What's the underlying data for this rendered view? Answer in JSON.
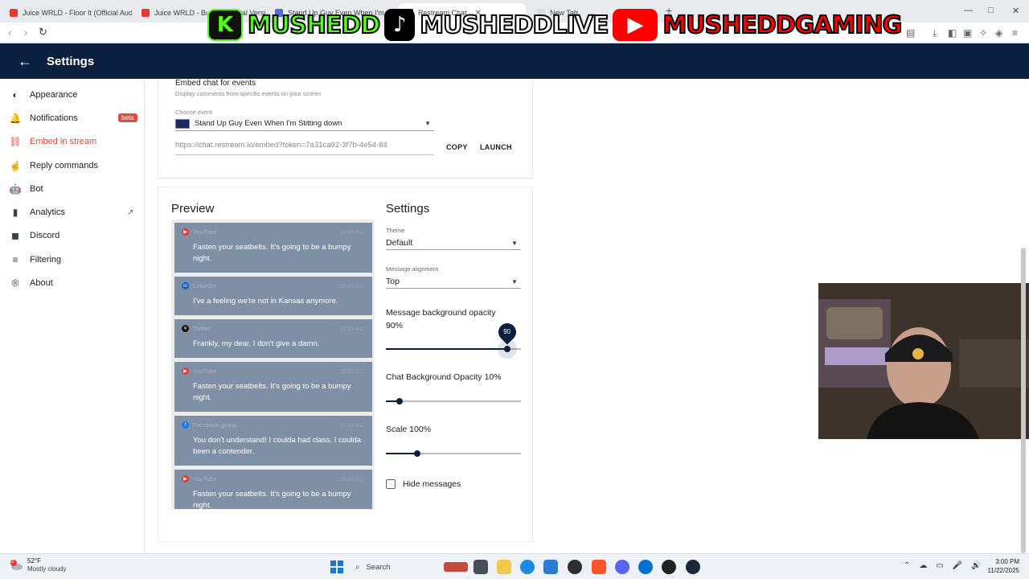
{
  "browser": {
    "tabs": [
      {
        "title": "Juice WRLD - Floor It (Official Audio)",
        "fav_color": "#e53935"
      },
      {
        "title": "Juice WRLD - Busch (Official Version)",
        "fav_color": "#e53935"
      },
      {
        "title": "Stand Up Guy Even When I'm Stitting down",
        "fav_color": "#4f6fd8"
      },
      {
        "title": "Restream Chat",
        "fav_color": "#111827",
        "active": true
      },
      {
        "title": "New Tab",
        "fav_color": "#dadce0"
      }
    ],
    "new_tab_glyph": "+",
    "window_controls": [
      "—",
      "□",
      "✕"
    ]
  },
  "overlay": {
    "kick_name": "MUSHEDD",
    "tiktok_name": "MUSHEDDLIVE",
    "youtube_name": "MUSHEDDGAMING",
    "kick_color": "#53fc18",
    "youtube_color": "#ff0000"
  },
  "header": {
    "back_glyph": "←",
    "title": "Settings"
  },
  "sidebar": {
    "items": [
      {
        "label": "Appearance",
        "icon": "contrast-icon",
        "glyph": "◐"
      },
      {
        "label": "Notifications",
        "icon": "bell-icon",
        "glyph": "🔔",
        "badge": "beta"
      },
      {
        "label": "Embed in stream",
        "icon": "link-icon",
        "glyph": "⛓",
        "active": true
      },
      {
        "label": "Reply commands",
        "icon": "touch-icon",
        "glyph": "☝"
      },
      {
        "label": "Bot",
        "icon": "robot-icon",
        "glyph": "🤖"
      },
      {
        "label": "Analytics",
        "icon": "bar-chart-icon",
        "glyph": "▮",
        "external": "↗"
      },
      {
        "label": "Discord",
        "icon": "discord-icon",
        "glyph": "◼"
      },
      {
        "label": "Filtering",
        "icon": "filter-icon",
        "glyph": "≡"
      },
      {
        "label": "About",
        "icon": "restream-logo-icon",
        "glyph": "®"
      }
    ]
  },
  "embed": {
    "title": "Embed chat for events",
    "subtitle": "Display comments from specific events on your screen",
    "choose_label": "Choose event",
    "event_value": "Stand Up Guy Even When I'm Stitting down",
    "url": "https://chat.restream.io/embed?token=7a31ca92-3f7b-4e54-84",
    "copy_label": "COPY",
    "launch_label": "LAUNCH"
  },
  "preview": {
    "title": "Preview",
    "messages": [
      {
        "platform": "YouTube",
        "color": "#e53935",
        "glyph": "▶",
        "time": "16:20:01",
        "text": "Fasten your seatbelts. It's going to be a bumpy night.",
        "lines": 2
      },
      {
        "platform": "LinkedIn",
        "color": "#0a66c2",
        "glyph": "in",
        "time": "16:20:01",
        "text": "I've a feeling we're not in Kansas anymore.",
        "lines": 1
      },
      {
        "platform": "Twitter",
        "color": "#111111",
        "glyph": "✕",
        "time": "16:20:01",
        "text": "Frankly, my dear, I don't give a damn.",
        "lines": 1
      },
      {
        "platform": "YouTube",
        "color": "#e53935",
        "glyph": "▶",
        "time": "16:20:01",
        "text": "Fasten your seatbelts. It's going to be a bumpy night.",
        "lines": 2
      },
      {
        "platform": "Facebook group",
        "color": "#1877f2",
        "glyph": "f",
        "time": "16:20:01",
        "text": "You don't understand! I coulda had class. I coulda been a contender.",
        "lines": 2
      },
      {
        "platform": "YouTube",
        "color": "#e53935",
        "glyph": "▶",
        "time": "16:20:01",
        "text": "Fasten your seatbelts. It's going to be a bumpy night.",
        "lines": 2
      }
    ]
  },
  "settings": {
    "title": "Settings",
    "theme_label": "Theme",
    "theme_value": "Default",
    "alignment_label": "Message alignment",
    "alignment_value": "Top",
    "msg_opacity_label": "Message background opacity",
    "msg_opacity_value": "90%",
    "msg_opacity_level": 0.9,
    "msg_opacity_bubble": "90",
    "chat_opacity_label": "Chat Background Opacity 10%",
    "chat_opacity_level": 0.1,
    "scale_label": "Scale 100%",
    "scale_level": 0.23,
    "hide_messages_label": "Hide messages"
  },
  "taskbar": {
    "weather_badge": "2",
    "temperature": "52°F",
    "weather_desc": "Mostly cloudy",
    "search_placeholder": "Search",
    "time": "3:00 PM",
    "date": "11/22/2025"
  }
}
